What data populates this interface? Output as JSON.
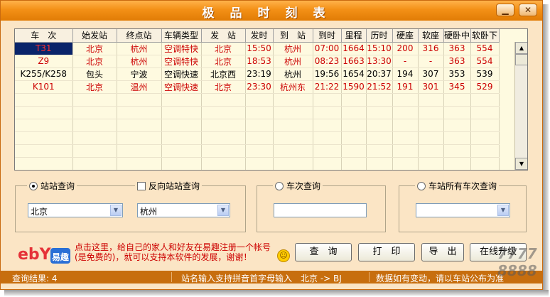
{
  "window": {
    "title": "极品时刻表",
    "min_label": "▁",
    "close_label": "✕"
  },
  "table": {
    "headers": [
      "车　次",
      "始发站",
      "终点站",
      "车辆类型",
      "发　站",
      "发时",
      "到　站",
      "到时",
      "里程",
      "历时",
      "硬座",
      "软座",
      "硬卧中",
      "软卧下"
    ],
    "rows": [
      {
        "color": "red",
        "cells": [
          "T31",
          "北京",
          "杭州",
          "空调特快",
          "北京",
          "15:50",
          "杭州",
          "07:00",
          "1664",
          "15:10",
          "200",
          "316",
          "363",
          "554"
        ]
      },
      {
        "color": "red",
        "cells": [
          "Z9",
          "北京",
          "杭州",
          "空调特快",
          "北京",
          "18:53",
          "杭州",
          "08:23",
          "1663",
          "13:30",
          "-",
          "-",
          "363",
          "554"
        ]
      },
      {
        "color": "black",
        "cells": [
          "K255/K258",
          "包头",
          "宁波",
          "空调快速",
          "北京西",
          "23:19",
          "杭州",
          "19:56",
          "1654",
          "20:37",
          "194",
          "307",
          "353",
          "539"
        ]
      },
      {
        "color": "red",
        "cells": [
          "K101",
          "北京",
          "温州",
          "空调快速",
          "北京",
          "23:30",
          "杭州东",
          "21:22",
          "1590",
          "21:52",
          "191",
          "301",
          "345",
          "529"
        ]
      }
    ]
  },
  "query": {
    "station": {
      "label": "站站查询",
      "selected": true,
      "from": "北京",
      "to": "杭州"
    },
    "reverse": {
      "label": "反向站站查询",
      "checked": false
    },
    "train": {
      "label": "车次查询",
      "selected": false,
      "value": ""
    },
    "all_trains": {
      "label": "车站所有车次查询",
      "selected": false,
      "value": ""
    }
  },
  "ad": {
    "logo_text": "ebY",
    "logo_sub": "易趣",
    "text": "点击这里，给自己的家人和好友在易趣注册一个帐号(是免费的)，就可以支持本软件的发展，谢谢！"
  },
  "buttons": {
    "search": "查　询",
    "print": "打　印",
    "export": "导　出",
    "upgrade": "在线升级"
  },
  "status": {
    "result": "查询结果: 4",
    "hint": "站名输入支持拼音首字母输入　北京 -> BJ",
    "note": "数据如有变动，请以车站公布为准"
  },
  "watermark": {
    "line1": "7777",
    "line2": "8888"
  }
}
